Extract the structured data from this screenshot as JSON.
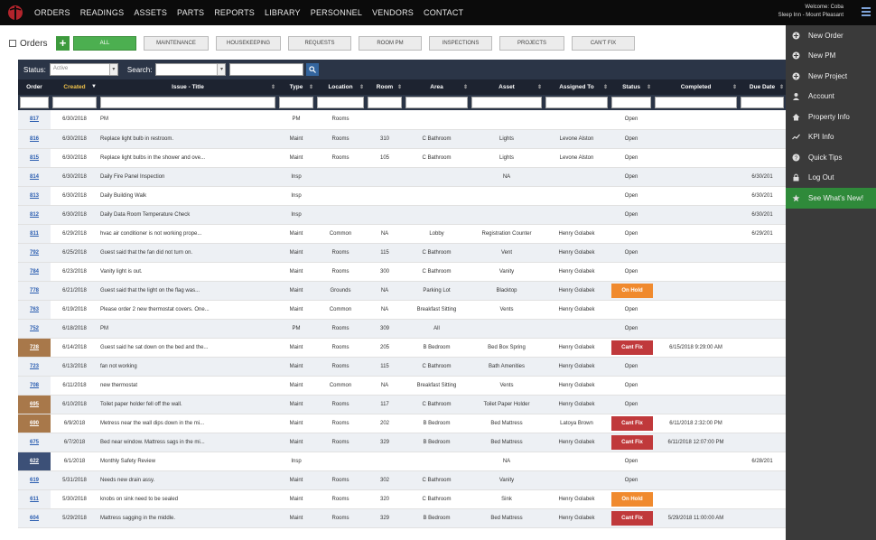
{
  "nav": {
    "items": [
      "ORDERS",
      "READINGS",
      "ASSETS",
      "PARTS",
      "REPORTS",
      "LIBRARY",
      "PERSONNEL",
      "VENDORS",
      "CONTACT"
    ],
    "welcome_line1": "Welcome: Coba",
    "welcome_line2": "Sleep Inn - Mount Pleasant"
  },
  "toolbar": {
    "title": "Orders",
    "add_label": "+",
    "filters": [
      "ALL",
      "MAINTENANCE",
      "HOUSEKEEPING",
      "REQUESTS",
      "ROOM PM",
      "INSPECTIONS",
      "PROJECTS",
      "CAN'T FIX"
    ],
    "active_filter": "ALL"
  },
  "search": {
    "status_label": "Status:",
    "status_value": "Active",
    "search_label": "Search:",
    "search_value": ""
  },
  "table": {
    "columns": [
      "Order",
      "Created",
      "Issue - Title",
      "Type",
      "Location",
      "Room",
      "Area",
      "Asset",
      "Assigned To",
      "Status",
      "Completed",
      "Due Date"
    ],
    "sorted_column": "Created",
    "rows": [
      {
        "order": "817",
        "created": "6/30/2018",
        "issue": "PM",
        "type": "PM",
        "location": "Rooms",
        "room": "",
        "area": "",
        "asset": "",
        "assigned": "",
        "status": "Open",
        "completed": "",
        "due": "",
        "mark": ""
      },
      {
        "order": "816",
        "created": "6/30/2018",
        "issue": "Replace light bulb in restroom.",
        "type": "Maint",
        "location": "Rooms",
        "room": "310",
        "area": "C Bathroom",
        "asset": "Lights",
        "assigned": "Levone Alston",
        "status": "Open",
        "completed": "",
        "due": "",
        "mark": ""
      },
      {
        "order": "815",
        "created": "6/30/2018",
        "issue": "Replace light bulbs in the shower and ove...",
        "type": "Maint",
        "location": "Rooms",
        "room": "105",
        "area": "C Bathroom",
        "asset": "Lights",
        "assigned": "Levone Alston",
        "status": "Open",
        "completed": "",
        "due": "",
        "mark": ""
      },
      {
        "order": "814",
        "created": "6/30/2018",
        "issue": "Daily Fire Panel Inspection",
        "type": "Insp",
        "location": "",
        "room": "",
        "area": "",
        "asset": "NA",
        "assigned": "",
        "status": "Open",
        "completed": "",
        "due": "6/30/201",
        "mark": ""
      },
      {
        "order": "813",
        "created": "6/30/2018",
        "issue": "Daily Building Walk",
        "type": "Insp",
        "location": "",
        "room": "",
        "area": "",
        "asset": "",
        "assigned": "",
        "status": "Open",
        "completed": "",
        "due": "6/30/201",
        "mark": ""
      },
      {
        "order": "812",
        "created": "6/30/2018",
        "issue": "Daily Data Room Temperature Check",
        "type": "Insp",
        "location": "",
        "room": "",
        "area": "",
        "asset": "",
        "assigned": "",
        "status": "Open",
        "completed": "",
        "due": "6/30/201",
        "mark": ""
      },
      {
        "order": "811",
        "created": "6/29/2018",
        "issue": "hvac air conditioner is not working prope...",
        "type": "Maint",
        "location": "Common",
        "room": "NA",
        "area": "Lobby",
        "asset": "Registration Counter",
        "assigned": "Henry Golabek",
        "status": "Open",
        "completed": "",
        "due": "6/29/201",
        "mark": ""
      },
      {
        "order": "792",
        "created": "6/25/2018",
        "issue": "Guest said that the fan did not turn on.",
        "type": "Maint",
        "location": "Rooms",
        "room": "115",
        "area": "C Bathroom",
        "asset": "Vent",
        "assigned": "Henry Golabek",
        "status": "Open",
        "completed": "",
        "due": "",
        "mark": ""
      },
      {
        "order": "784",
        "created": "6/23/2018",
        "issue": "Vanity light is out.",
        "type": "Maint",
        "location": "Rooms",
        "room": "300",
        "area": "C Bathroom",
        "asset": "Vanity",
        "assigned": "Henry Golabek",
        "status": "Open",
        "completed": "",
        "due": "",
        "mark": ""
      },
      {
        "order": "778",
        "created": "6/21/2018",
        "issue": "Guest said that the light on the flag was...",
        "type": "Maint",
        "location": "Grounds",
        "room": "NA",
        "area": "Parking Lot",
        "asset": "Blacktop",
        "assigned": "Henry Golabek",
        "status": "On Hold",
        "completed": "",
        "due": "",
        "mark": ""
      },
      {
        "order": "763",
        "created": "6/19/2018",
        "issue": "Please order 2 new thermostat covers. One...",
        "type": "Maint",
        "location": "Common",
        "room": "NA",
        "area": "Breakfast Sitting",
        "asset": "Vents",
        "assigned": "Henry Golabek",
        "status": "Open",
        "completed": "",
        "due": "",
        "mark": ""
      },
      {
        "order": "752",
        "created": "6/18/2018",
        "issue": "PM",
        "type": "PM",
        "location": "Rooms",
        "room": "309",
        "area": "All",
        "asset": "",
        "assigned": "",
        "status": "Open",
        "completed": "",
        "due": "",
        "mark": ""
      },
      {
        "order": "728",
        "created": "6/14/2018",
        "issue": "Guest said he sat down on the bed and the...",
        "type": "Maint",
        "location": "Rooms",
        "room": "205",
        "area": "B Bedroom",
        "asset": "Bed Box Spring",
        "assigned": "Henry Golabek",
        "status": "Cant Fix",
        "completed": "6/15/2018 9:29:00 AM",
        "due": "",
        "mark": "brown"
      },
      {
        "order": "723",
        "created": "6/13/2018",
        "issue": "fan not working",
        "type": "Maint",
        "location": "Rooms",
        "room": "115",
        "area": "C Bathroom",
        "asset": "Bath Amenities",
        "assigned": "Henry Golabek",
        "status": "Open",
        "completed": "",
        "due": "",
        "mark": ""
      },
      {
        "order": "708",
        "created": "6/11/2018",
        "issue": "new thermostat",
        "type": "Maint",
        "location": "Common",
        "room": "NA",
        "area": "Breakfast Sitting",
        "asset": "Vents",
        "assigned": "Henry Golabek",
        "status": "Open",
        "completed": "",
        "due": "",
        "mark": ""
      },
      {
        "order": "695",
        "created": "6/10/2018",
        "issue": "Toilet paper holder fell off the wall.",
        "type": "Maint",
        "location": "Rooms",
        "room": "117",
        "area": "C Bathroom",
        "asset": "Toilet Paper Holder",
        "assigned": "Henry Golabek",
        "status": "Open",
        "completed": "",
        "due": "",
        "mark": "brown"
      },
      {
        "order": "690",
        "created": "6/9/2018",
        "issue": "Metress near the wall dips down in the mi...",
        "type": "Maint",
        "location": "Rooms",
        "room": "202",
        "area": "B Bedroom",
        "asset": "Bed Mattress",
        "assigned": "Latoya Brown",
        "status": "Cant Fix",
        "completed": "6/11/2018 2:32:00 PM",
        "due": "",
        "mark": "brown"
      },
      {
        "order": "675",
        "created": "6/7/2018",
        "issue": "Bed near window. Mattress sags in the mi...",
        "type": "Maint",
        "location": "Rooms",
        "room": "329",
        "area": "B Bedroom",
        "asset": "Bed Mattress",
        "assigned": "Henry Golabek",
        "status": "Cant Fix",
        "completed": "6/11/2018 12:07:00 PM",
        "due": "",
        "mark": ""
      },
      {
        "order": "622",
        "created": "6/1/2018",
        "issue": "Monthly Safety Review",
        "type": "Insp",
        "location": "",
        "room": "",
        "area": "",
        "asset": "NA",
        "assigned": "",
        "status": "Open",
        "completed": "",
        "due": "6/28/201",
        "mark": "navy"
      },
      {
        "order": "619",
        "created": "5/31/2018",
        "issue": "Needs new drain assy.",
        "type": "Maint",
        "location": "Rooms",
        "room": "302",
        "area": "C Bathroom",
        "asset": "Vanity",
        "assigned": "",
        "status": "Open",
        "completed": "",
        "due": "",
        "mark": ""
      },
      {
        "order": "611",
        "created": "5/30/2018",
        "issue": "knobs on sink need to be sealed",
        "type": "Maint",
        "location": "Rooms",
        "room": "320",
        "area": "C Bathroom",
        "asset": "Sink",
        "assigned": "Henry Golabek",
        "status": "On Hold",
        "completed": "",
        "due": "",
        "mark": ""
      },
      {
        "order": "604",
        "created": "5/29/2018",
        "issue": "Mattress sagging in the middle.",
        "type": "Maint",
        "location": "Rooms",
        "room": "329",
        "area": "B Bedroom",
        "asset": "Bed Mattress",
        "assigned": "Henry Golabek",
        "status": "Cant Fix",
        "completed": "5/29/2018 11:00:00 AM",
        "due": "",
        "mark": ""
      }
    ]
  },
  "side_menu": {
    "items": [
      {
        "label": "New Order",
        "icon": "plus-circle-icon"
      },
      {
        "label": "New PM",
        "icon": "plus-circle-icon"
      },
      {
        "label": "New Project",
        "icon": "plus-circle-icon"
      },
      {
        "label": "Account",
        "icon": "user-icon"
      },
      {
        "label": "Property Info",
        "icon": "home-icon"
      },
      {
        "label": "KPI Info",
        "icon": "trend-icon"
      },
      {
        "label": "Quick Tips",
        "icon": "question-icon"
      },
      {
        "label": "Log Out",
        "icon": "lock-icon"
      },
      {
        "label": "See What's New!",
        "icon": "star-icon",
        "highlight": true
      }
    ]
  },
  "colors": {
    "accent_green": "#4caf50",
    "on_hold": "#f08a2e",
    "cant_fix": "#c0393b",
    "header_dark": "#1d2330"
  }
}
